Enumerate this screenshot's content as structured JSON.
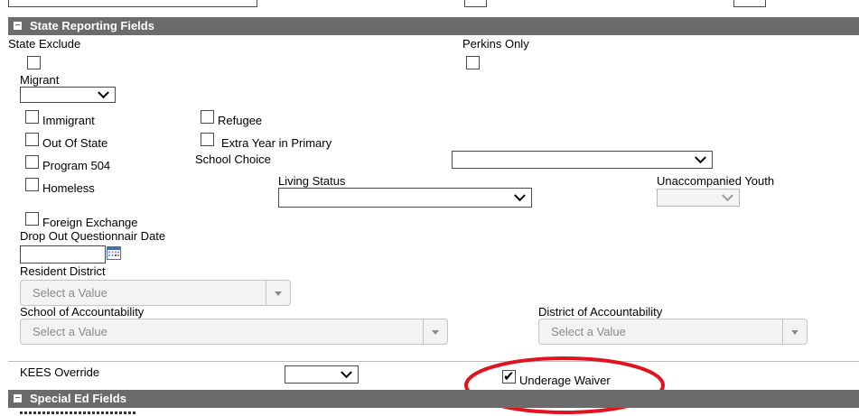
{
  "sections": {
    "state": {
      "toggle": "−",
      "title": "State Reporting Fields"
    },
    "special_ed": {
      "toggle": "−",
      "title": "Special Ed Fields"
    }
  },
  "fields": {
    "state_exclude": "State Exclude",
    "perkins_only": "Perkins Only",
    "migrant": "Migrant",
    "immigrant": "Immigrant",
    "refugee": "Refugee",
    "out_of_state": "Out Of State",
    "extra_year_primary": "Extra Year in Primary",
    "program_504": "Program 504",
    "school_choice": "School Choice",
    "homeless": "Homeless",
    "living_status": "Living Status",
    "unaccompanied_youth": "Unaccompanied Youth",
    "foreign_exchange": "Foreign Exchange",
    "drop_out_date": "Drop Out Questionnair Date",
    "resident_district": "Resident District",
    "resident_district_placeholder": "Select a Value",
    "school_of_accountability": "School of Accountability",
    "school_of_accountability_placeholder": "Select a Value",
    "district_of_accountability": "District of Accountability",
    "district_of_accountability_placeholder": "Select a Value",
    "kees_override": "KEES Override",
    "underage_waiver": "Underage Waiver"
  },
  "checkbox_states": {
    "state_exclude": false,
    "perkins_only": false,
    "immigrant": false,
    "refugee": false,
    "out_of_state": false,
    "extra_year_primary": false,
    "program_504": false,
    "homeless": false,
    "foreign_exchange": false,
    "underage_waiver": true
  },
  "colors": {
    "section_header_bg": "#6b6b6b",
    "annotation_ellipse": "#e0141e"
  },
  "icons": [
    "minus-icon",
    "chevron-down-icon",
    "calendar-icon",
    "checkmark-icon"
  ]
}
